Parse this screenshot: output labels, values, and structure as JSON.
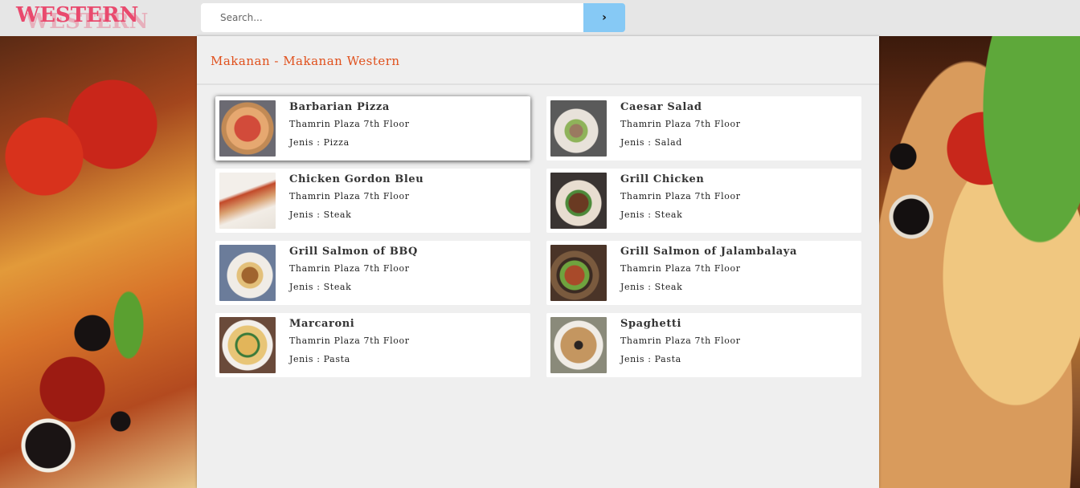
{
  "header": {
    "logo_text": "WESTERN",
    "search": {
      "placeholder": "Search...",
      "value": ""
    },
    "search_button_label": "›"
  },
  "page": {
    "title": "Makanan - Makanan Western"
  },
  "items": [
    {
      "name": "Barbarian Pizza",
      "location": "Thamrin Plaza 7th Floor",
      "type": "Jenis : Pizza",
      "thumb": "pizza"
    },
    {
      "name": "Caesar Salad",
      "location": "Thamrin Plaza 7th Floor",
      "type": "Jenis : Salad",
      "thumb": "caesar"
    },
    {
      "name": "Chicken Gordon Bleu",
      "location": "Thamrin Plaza 7th Floor",
      "type": "Jenis : Steak",
      "thumb": "gordon"
    },
    {
      "name": "Grill Chicken",
      "location": "Thamrin Plaza 7th Floor",
      "type": "Jenis : Steak",
      "thumb": "grill"
    },
    {
      "name": "Grill Salmon of BBQ",
      "location": "Thamrin Plaza 7th Floor",
      "type": "Jenis : Steak",
      "thumb": "bbq"
    },
    {
      "name": "Grill Salmon of Jalambalaya",
      "location": "Thamrin Plaza 7th Floor",
      "type": "Jenis : Steak",
      "thumb": "jalam"
    },
    {
      "name": "Marcaroni",
      "location": "Thamrin Plaza 7th Floor",
      "type": "Jenis : Pasta",
      "thumb": "macaroni"
    },
    {
      "name": "Spaghetti",
      "location": "Thamrin Plaza 7th Floor",
      "type": "Jenis : Pasta",
      "thumb": "spaghetti"
    }
  ],
  "colors": {
    "accent_title": "#e0501c",
    "logo": "#e94a6e",
    "search_button": "#86c9f5"
  }
}
